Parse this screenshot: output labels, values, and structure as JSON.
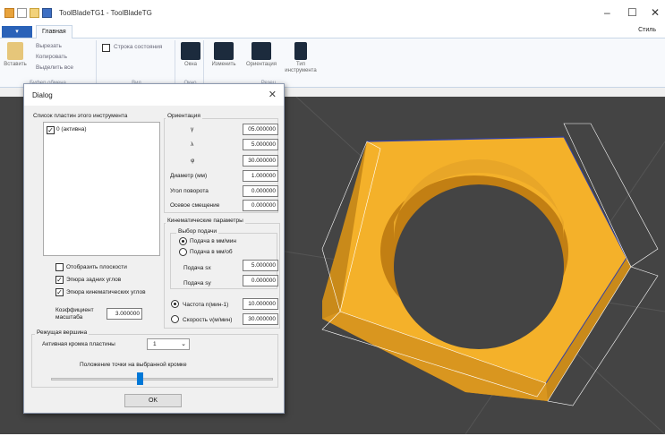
{
  "window": {
    "title": "ToolBladeTG1 - ToolBladeTG",
    "minimize": "–",
    "maximize": "☐",
    "close": "✕"
  },
  "ribbon": {
    "tab_home": "Главная",
    "style_menu": "Стиль",
    "clipboard": {
      "paste": "Вставить",
      "cut": "Вырезать",
      "copy": "Копировать",
      "select_all": "Выделить все",
      "group": "Буфер обмена"
    },
    "view": {
      "status_bar": "Строка состояния",
      "group": "Вид"
    },
    "windows": {
      "windows": "Окна",
      "group": "Окно"
    },
    "cutter": {
      "change": "Изменить",
      "orientation": "Ориентация",
      "tool_type_1": "Тип",
      "tool_type_2": "инструмента",
      "group": "Резец"
    }
  },
  "dialog": {
    "title": "Dialog",
    "close": "✕",
    "plates_header": "Список пластин этого инструмента",
    "plate_item": "0 (активна)",
    "show_planes": "Отобразить плоскости",
    "rear_angles": "Эпюра задних углов",
    "kinematic_angles": "Эпюра кинематических углов",
    "scale_label_1": "Коэффициент",
    "scale_label_2": "масштаба",
    "scale_value": "3.000000",
    "orientation": {
      "header": "Ориентация",
      "gamma": "γ",
      "gamma_value": "05.000000",
      "lambda": "λ",
      "lambda_value": "5.000000",
      "phi": "φ",
      "phi_value": "30.000000",
      "diameter": "Диаметр (мм)",
      "diameter_value": "1.000000",
      "rotation": "Угол поворота",
      "rotation_value": "0.000000",
      "axial": "Осевое смещение",
      "axial_value": "0.000000"
    },
    "kinematic": {
      "header": "Кинематические параметры",
      "feed_choice": "Выбор подачи",
      "feed_mm_min": "Подача в мм/мин",
      "feed_mm_rev": "Подача в мм/об",
      "feed_sx": "Подача sx",
      "feed_sx_value": "5.000000",
      "feed_sy": "Подача sy",
      "feed_sy_value": "0.000000",
      "freq": "Частота n(мин-1)",
      "freq_value": "10.000000",
      "speed": "Скорость v(м/мин)",
      "speed_value": "30.000000"
    },
    "cutting_vertex": {
      "header": "Режущая вершина",
      "active_edge": "Активная кромка пластины",
      "active_edge_value": "1",
      "point_position": "Положение точки на выбранной кромке",
      "point_position_fraction": 0.38
    },
    "ok": "OK"
  },
  "colors": {
    "accent": "#0078d7",
    "blade": "#f4b12a",
    "viewport": "#444444"
  }
}
